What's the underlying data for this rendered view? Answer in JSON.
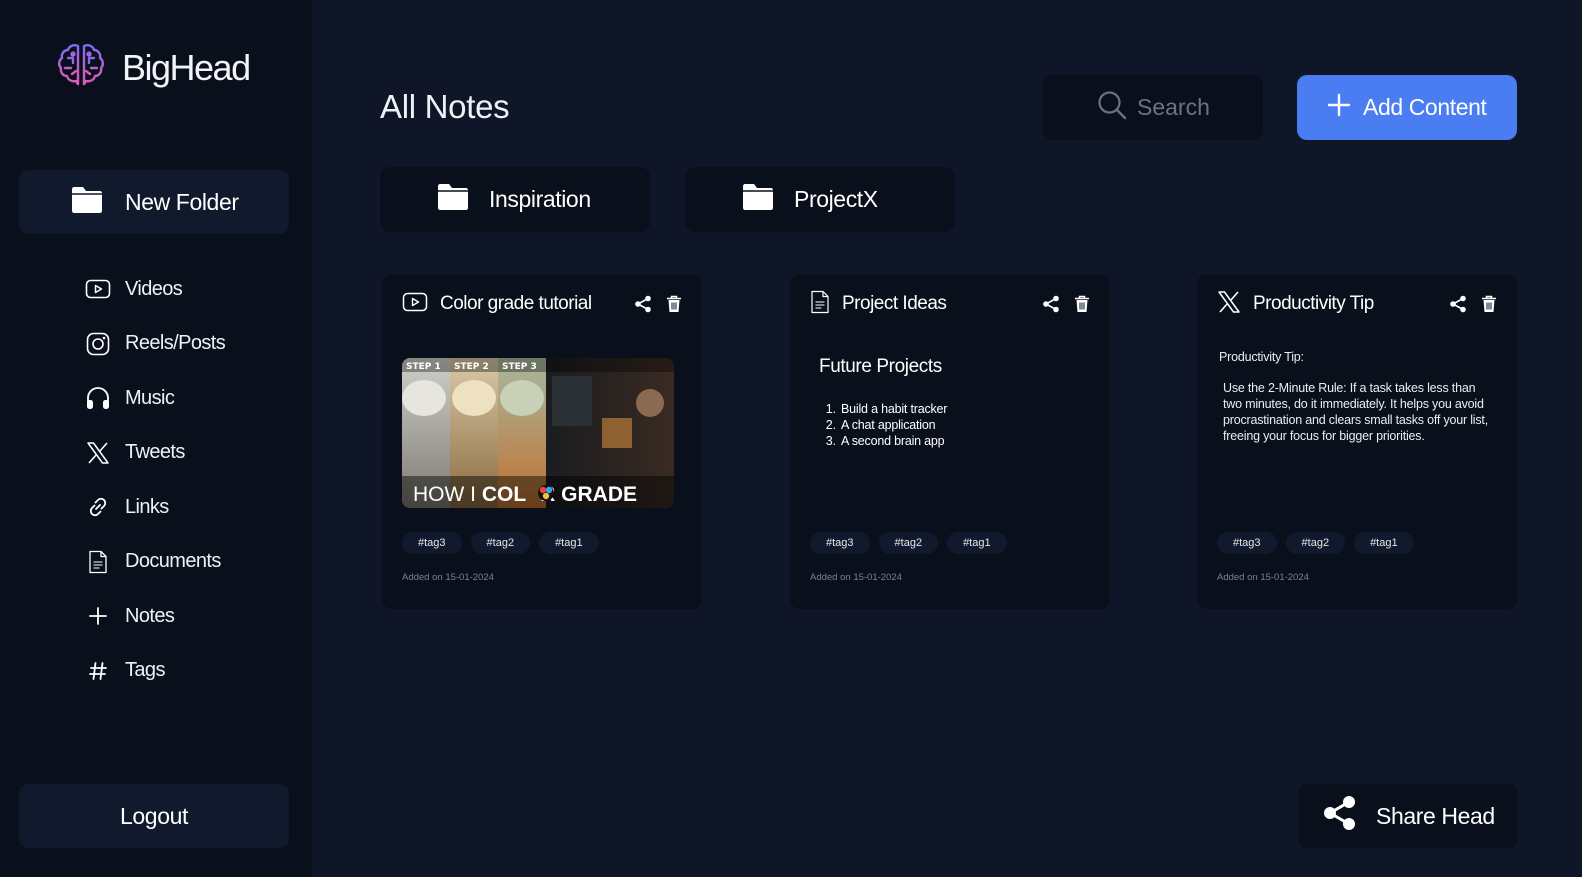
{
  "app": {
    "name": "BigHead"
  },
  "colors": {
    "background": "#0f1628",
    "sidebar": "#0a0f1c",
    "accent": "#4a7cf2",
    "card": "#0a0f1c"
  },
  "sidebar": {
    "new_folder": {
      "label": "New Folder",
      "icon": "folder-icon"
    },
    "items": [
      {
        "label": "Videos",
        "icon": "video-icon"
      },
      {
        "label": "Reels/Posts",
        "icon": "instagram-icon"
      },
      {
        "label": "Music",
        "icon": "headphones-icon"
      },
      {
        "label": "Tweets",
        "icon": "x-icon"
      },
      {
        "label": "Links",
        "icon": "link-icon"
      },
      {
        "label": "Documents",
        "icon": "document-icon"
      },
      {
        "label": "Notes",
        "icon": "plus-icon"
      },
      {
        "label": "Tags",
        "icon": "hash-icon"
      }
    ],
    "logout_label": "Logout"
  },
  "header": {
    "title": "All Notes",
    "search_placeholder": "Search",
    "add_content_label": "Add Content"
  },
  "folders": [
    {
      "label": "Inspiration"
    },
    {
      "label": "ProjectX"
    }
  ],
  "cards": [
    {
      "type_icon": "video-icon",
      "title": "Color grade tutorial",
      "thumbnail": {
        "steps": [
          "STEP 1",
          "STEP 2",
          "STEP 3"
        ],
        "caption_left": "HOW I ",
        "caption_right": "COL",
        "caption_end": "R GRADE"
      },
      "tags": [
        "#tag3",
        "#tag2",
        "#tag1"
      ],
      "date": "Added on 15-01-2024"
    },
    {
      "type_icon": "document-icon",
      "title": "Project Ideas",
      "heading": "Future Projects",
      "items": [
        "Build a habit tracker",
        "A chat application",
        "A second brain app"
      ],
      "tags": [
        "#tag3",
        "#tag2",
        "#tag1"
      ],
      "date": "Added on 15-01-2024"
    },
    {
      "type_icon": "x-icon",
      "title": "Productivity Tip",
      "line1": "Productivity Tip:",
      "body": "Use the 2-Minute Rule: If a task takes less than two minutes, do it immediately. It helps you avoid procrastination and clears small tasks off your list, freeing your focus for bigger priorities.",
      "tags": [
        "#tag3",
        "#tag2",
        "#tag1"
      ],
      "date": "Added on 15-01-2024"
    }
  ],
  "share_head_label": "Share Head"
}
